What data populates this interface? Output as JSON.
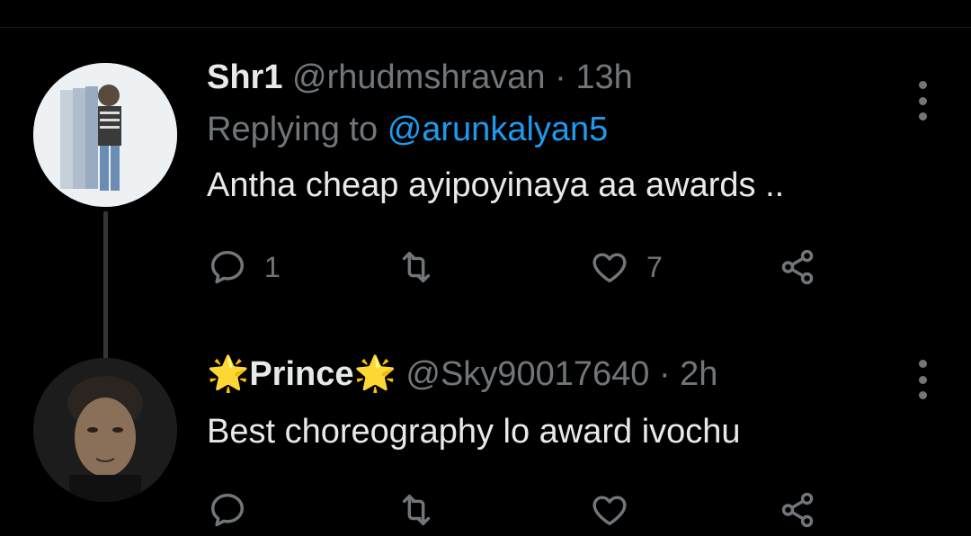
{
  "tweets": [
    {
      "display_name": "Shr1",
      "handle": "@rhudmshravan",
      "separator": "·",
      "time": "13h",
      "replying_prefix": "Replying to",
      "replying_to": "@arunkalyan5",
      "text": "Antha cheap ayipoyinaya aa awards ..",
      "reply_count": "1",
      "retweet_count": "",
      "like_count": "7"
    },
    {
      "display_name_prefix_emoji": "🌟",
      "display_name": "Prince",
      "display_name_suffix_emoji": "🌟",
      "handle": "@Sky90017640",
      "separator": "·",
      "time": "2h",
      "text": "Best choreography lo award ivochu",
      "reply_count": "",
      "retweet_count": "",
      "like_count": ""
    }
  ],
  "icons": {
    "reply": "reply-icon",
    "retweet": "retweet-icon",
    "like": "heart-icon",
    "share": "share-icon",
    "more": "more-options-icon"
  },
  "colors": {
    "background": "#000000",
    "text_primary": "#e7e9ea",
    "text_secondary": "#71767b",
    "link": "#1d9bf0",
    "thread_line": "#333639"
  }
}
